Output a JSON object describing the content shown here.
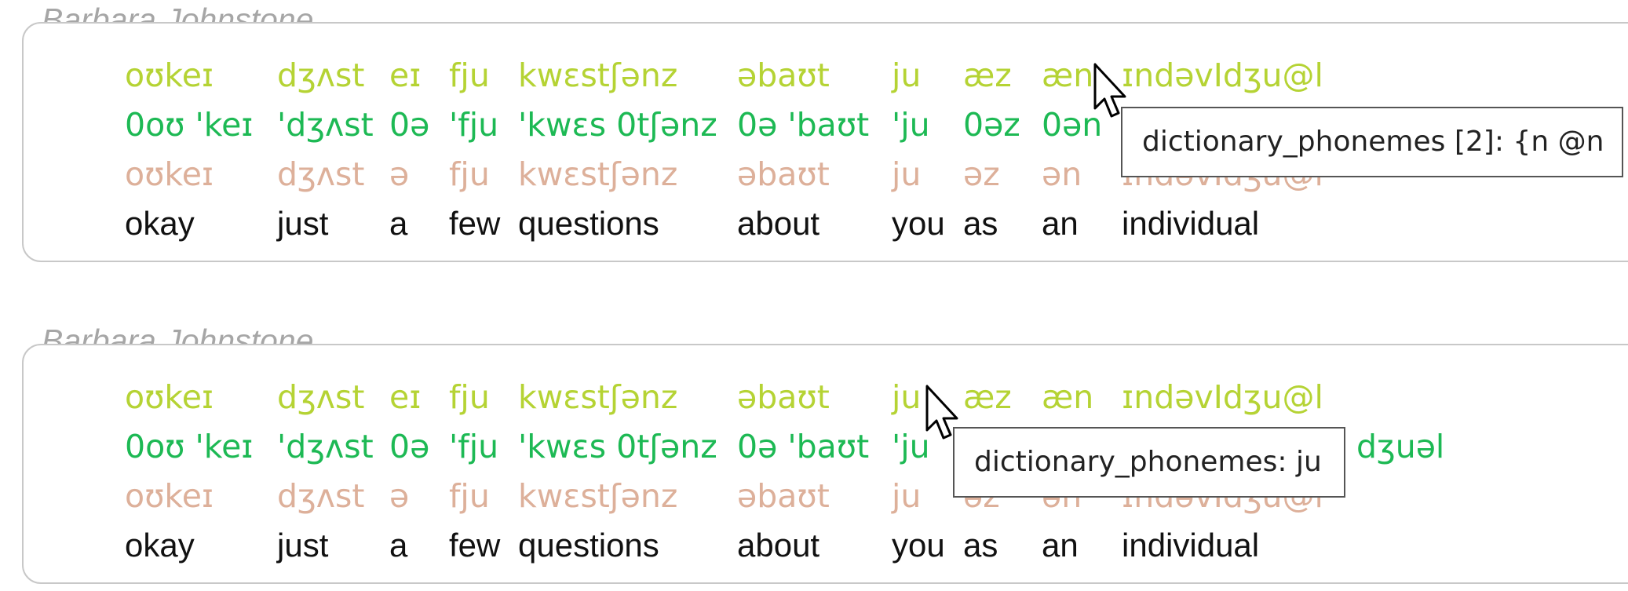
{
  "panels": [
    {
      "speaker": "Barbara Johnstone",
      "tiers": [
        [
          "oʊkeɪ",
          "dʒʌst",
          "eɪ",
          "fju",
          "kwɛstʃənz",
          "əbaʊt",
          "ju",
          "æz",
          "æn",
          "ɪndəvIdʒu@l"
        ],
        [
          "0oʊ 'keɪ",
          "'dʒʌst",
          "0ə",
          "'fju",
          "'kwɛs 0tʃənz",
          "0ə 'baʊt",
          "'ju",
          "0əz",
          "0ən",
          ""
        ],
        [
          "oʊkeɪ",
          "dʒʌst",
          "ə",
          "fju",
          "kwɛstʃənz",
          "əbaʊt",
          "ju",
          "əz",
          "ən",
          "ɪndəvIdʒu@l"
        ],
        [
          "okay",
          "just",
          "a",
          "few",
          "questions",
          "about",
          "you",
          "as",
          "an",
          "individual"
        ]
      ],
      "tooltip": "dictionary_phonemes [2]: {n @n"
    },
    {
      "speaker": "Barbara Johnstone",
      "tiers": [
        [
          "oʊkeɪ",
          "dʒʌst",
          "eɪ",
          "fju",
          "kwɛstʃənz",
          "əbaʊt",
          "ju",
          "æz",
          "æn",
          "ɪndəvIdʒu@l"
        ],
        [
          "0oʊ 'keɪ",
          "'dʒʌst",
          "0ə",
          "'fju",
          "'kwɛs 0tʃənz",
          "0ə 'baʊt",
          "'ju",
          "",
          "",
          "dʒuəl"
        ],
        [
          "oʊkeɪ",
          "dʒʌst",
          "ə",
          "fju",
          "kwɛstʃənz",
          "əbaʊt",
          "ju",
          "əz",
          "ən",
          "ɪndəvIdʒu@l"
        ],
        [
          "okay",
          "just",
          "a",
          "few",
          "questions",
          "about",
          "you",
          "as",
          "an",
          "individual"
        ]
      ],
      "tooltip": "dictionary_phonemes: ju"
    }
  ],
  "colors": {
    "tier_phonetic": "#b5d334",
    "tier_dictionary": "#1db954",
    "tier_phonemes": "#ddb09a",
    "tier_words": "#111111",
    "speaker": "#a6a6a6"
  }
}
